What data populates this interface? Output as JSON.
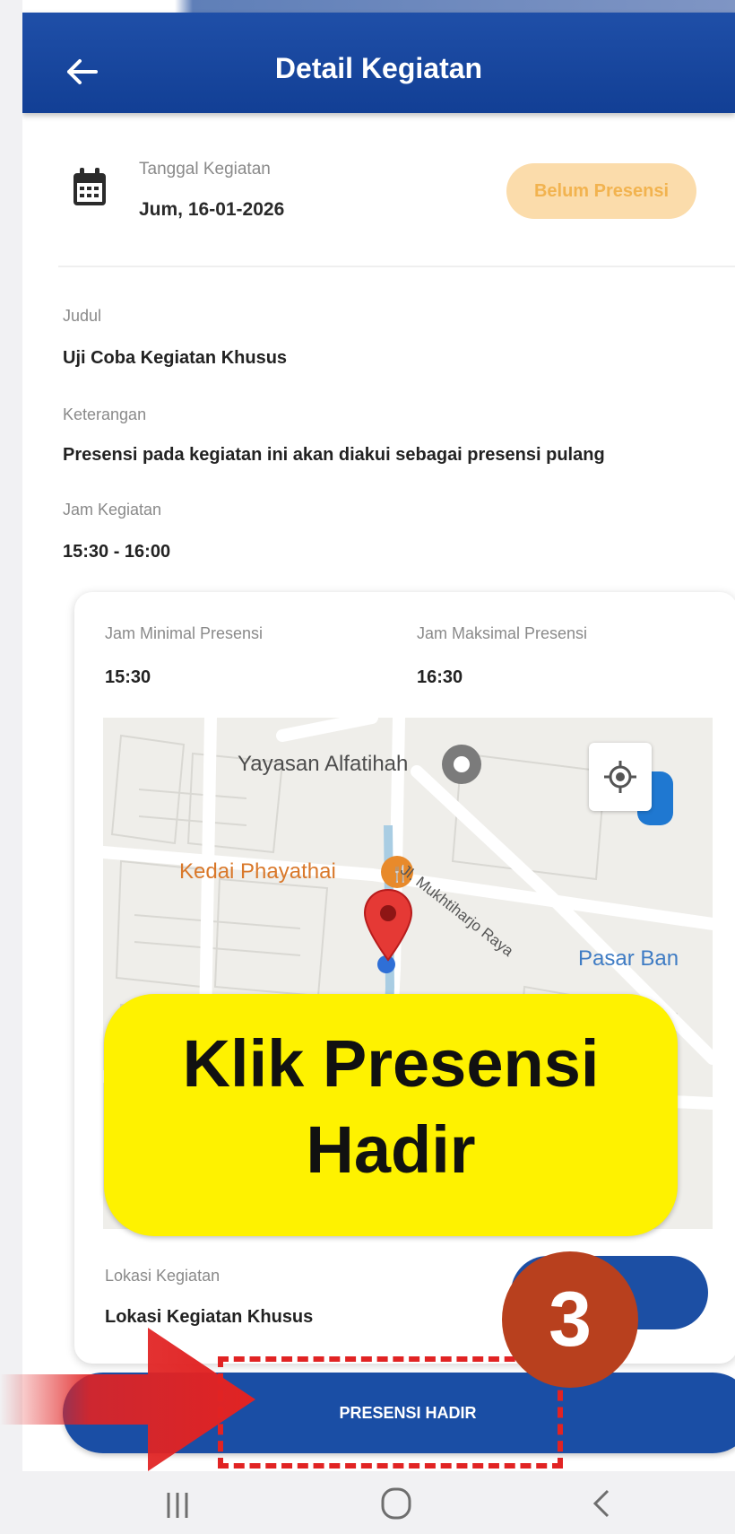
{
  "app_bar": {
    "title": "Detail Kegiatan",
    "back_icon": "arrow-left-icon"
  },
  "date_section": {
    "icon": "calendar-icon",
    "label": "Tanggal Kegiatan",
    "value": "Jum, 16-01-2026",
    "status_badge": "Belum Presensi"
  },
  "details": {
    "judul_label": "Judul",
    "judul_value": "Uji Coba Kegiatan Khusus",
    "keterangan_label": "Keterangan",
    "keterangan_value": "Presensi pada kegiatan ini akan diakui sebagai presensi pulang",
    "jam_label": "Jam Kegiatan",
    "jam_value": "15:30 - 16:00"
  },
  "card": {
    "min_label": "Jam Minimal Presensi",
    "min_value": "15:30",
    "max_label": "Jam Maksimal Presensi",
    "max_value": "16:30",
    "lokasi_label": "Lokasi Kegiatan",
    "lokasi_value": "Lokasi Kegiatan Khusus"
  },
  "map": {
    "labels": {
      "yayasan": "Yayasan Alfatihah",
      "kedai": "Kedai Phayathai",
      "road": "Jl. Mukhtiharjo Raya",
      "pasar": "Pasar Ban"
    },
    "locate_icon": "my-location-icon",
    "pin_icon": "map-pin-icon"
  },
  "primary_button": "PRESENSI HADIR",
  "annotation": {
    "callout_line1": "Klik Presensi",
    "callout_line2": "Hadir",
    "step_number": "3"
  },
  "nav": {
    "recent_icon": "recent-apps-icon",
    "home_icon": "home-icon",
    "back_icon": "nav-back-icon"
  },
  "colors": {
    "primary": "#1a4ea5",
    "badge_bg": "#fbdcab",
    "badge_text": "#f2b34f",
    "callout": "#fef200",
    "step_badge": "#b8401e",
    "highlight": "#e12323"
  }
}
